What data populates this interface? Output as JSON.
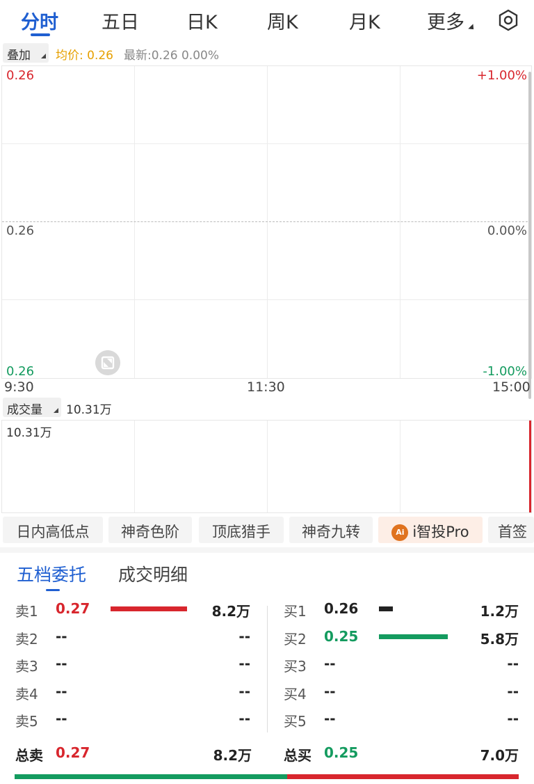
{
  "tabs": [
    {
      "label": "分时",
      "active": true
    },
    {
      "label": "五日"
    },
    {
      "label": "日K"
    },
    {
      "label": "周K"
    },
    {
      "label": "月K"
    },
    {
      "label": "更多"
    }
  ],
  "overlay": {
    "button": "叠加",
    "avg_label": "均价: 0.26",
    "latest_label": "最新:0.26 0.00%"
  },
  "price_chart": {
    "top_price": "0.26",
    "mid_price": "0.26",
    "bottom_price": "0.26",
    "top_pct": "+1.00%",
    "mid_pct": "0.00%",
    "bottom_pct": "-1.00%",
    "times": [
      "9:30",
      "11:30",
      "15:00"
    ]
  },
  "volume": {
    "button": "成交量",
    "value": "10.31万",
    "axis_label": "10.31万"
  },
  "indicators": [
    "日内高低点",
    "神奇色阶",
    "顶底猎手",
    "神奇九转",
    "i智投Pro",
    "首签"
  ],
  "ai_badge": "Ai",
  "order_book": {
    "tabs": [
      "五档委托",
      "成交明细"
    ],
    "sell": [
      {
        "label": "卖1",
        "price": "0.27",
        "volume": "8.2万",
        "bar": 1.0
      },
      {
        "label": "卖2",
        "price": "--",
        "volume": "--",
        "bar": 0
      },
      {
        "label": "卖3",
        "price": "--",
        "volume": "--",
        "bar": 0
      },
      {
        "label": "卖4",
        "price": "--",
        "volume": "--",
        "bar": 0
      },
      {
        "label": "卖5",
        "price": "--",
        "volume": "--",
        "bar": 0
      }
    ],
    "buy": [
      {
        "label": "买1",
        "price": "0.26",
        "volume": "1.2万",
        "bar": 0.18
      },
      {
        "label": "买2",
        "price": "0.25",
        "volume": "5.8万",
        "bar": 0.9
      },
      {
        "label": "买3",
        "price": "--",
        "volume": "--",
        "bar": 0
      },
      {
        "label": "买4",
        "price": "--",
        "volume": "--",
        "bar": 0
      },
      {
        "label": "买5",
        "price": "--",
        "volume": "--",
        "bar": 0
      }
    ],
    "total_sell": {
      "label": "总卖",
      "price": "0.27",
      "volume": "8.2万"
    },
    "total_buy": {
      "label": "总买",
      "price": "0.25",
      "volume": "7.0万"
    },
    "sell_ratio": 0.54
  },
  "colors": {
    "accent": "#1f5fd1",
    "up": "#d8262d",
    "down": "#149b5f",
    "avg": "#e6a000"
  }
}
